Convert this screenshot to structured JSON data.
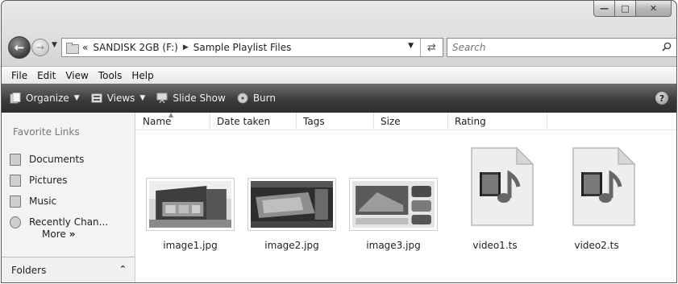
{
  "address": {
    "path_prefix": "«",
    "segments": [
      "SANDISK 2GB (F:)",
      "Sample Playlist Files"
    ],
    "search_placeholder": "Search"
  },
  "menu": [
    "File",
    "Edit",
    "View",
    "Tools",
    "Help"
  ],
  "commands": {
    "organize": "Organize",
    "views": "Views",
    "slideshow": "Slide Show",
    "burn": "Burn",
    "help": "?"
  },
  "sidebar": {
    "favorites_title": "Favorite Links",
    "items": [
      {
        "label": "Documents",
        "icon": "documents-icon"
      },
      {
        "label": "Pictures",
        "icon": "pictures-icon"
      },
      {
        "label": "Music",
        "icon": "music-icon"
      },
      {
        "label": "Recently Chan...",
        "icon": "recent-icon"
      }
    ],
    "more": "More",
    "more_glyph": "»",
    "folders": "Folders"
  },
  "columns": [
    "Name",
    "Date taken",
    "Tags",
    "Size",
    "Rating"
  ],
  "files": [
    {
      "name": "image1.jpg",
      "type": "image"
    },
    {
      "name": "image2.jpg",
      "type": "image"
    },
    {
      "name": "image3.jpg",
      "type": "image"
    },
    {
      "name": "video1.ts",
      "type": "video"
    },
    {
      "name": "video2.ts",
      "type": "video"
    }
  ]
}
